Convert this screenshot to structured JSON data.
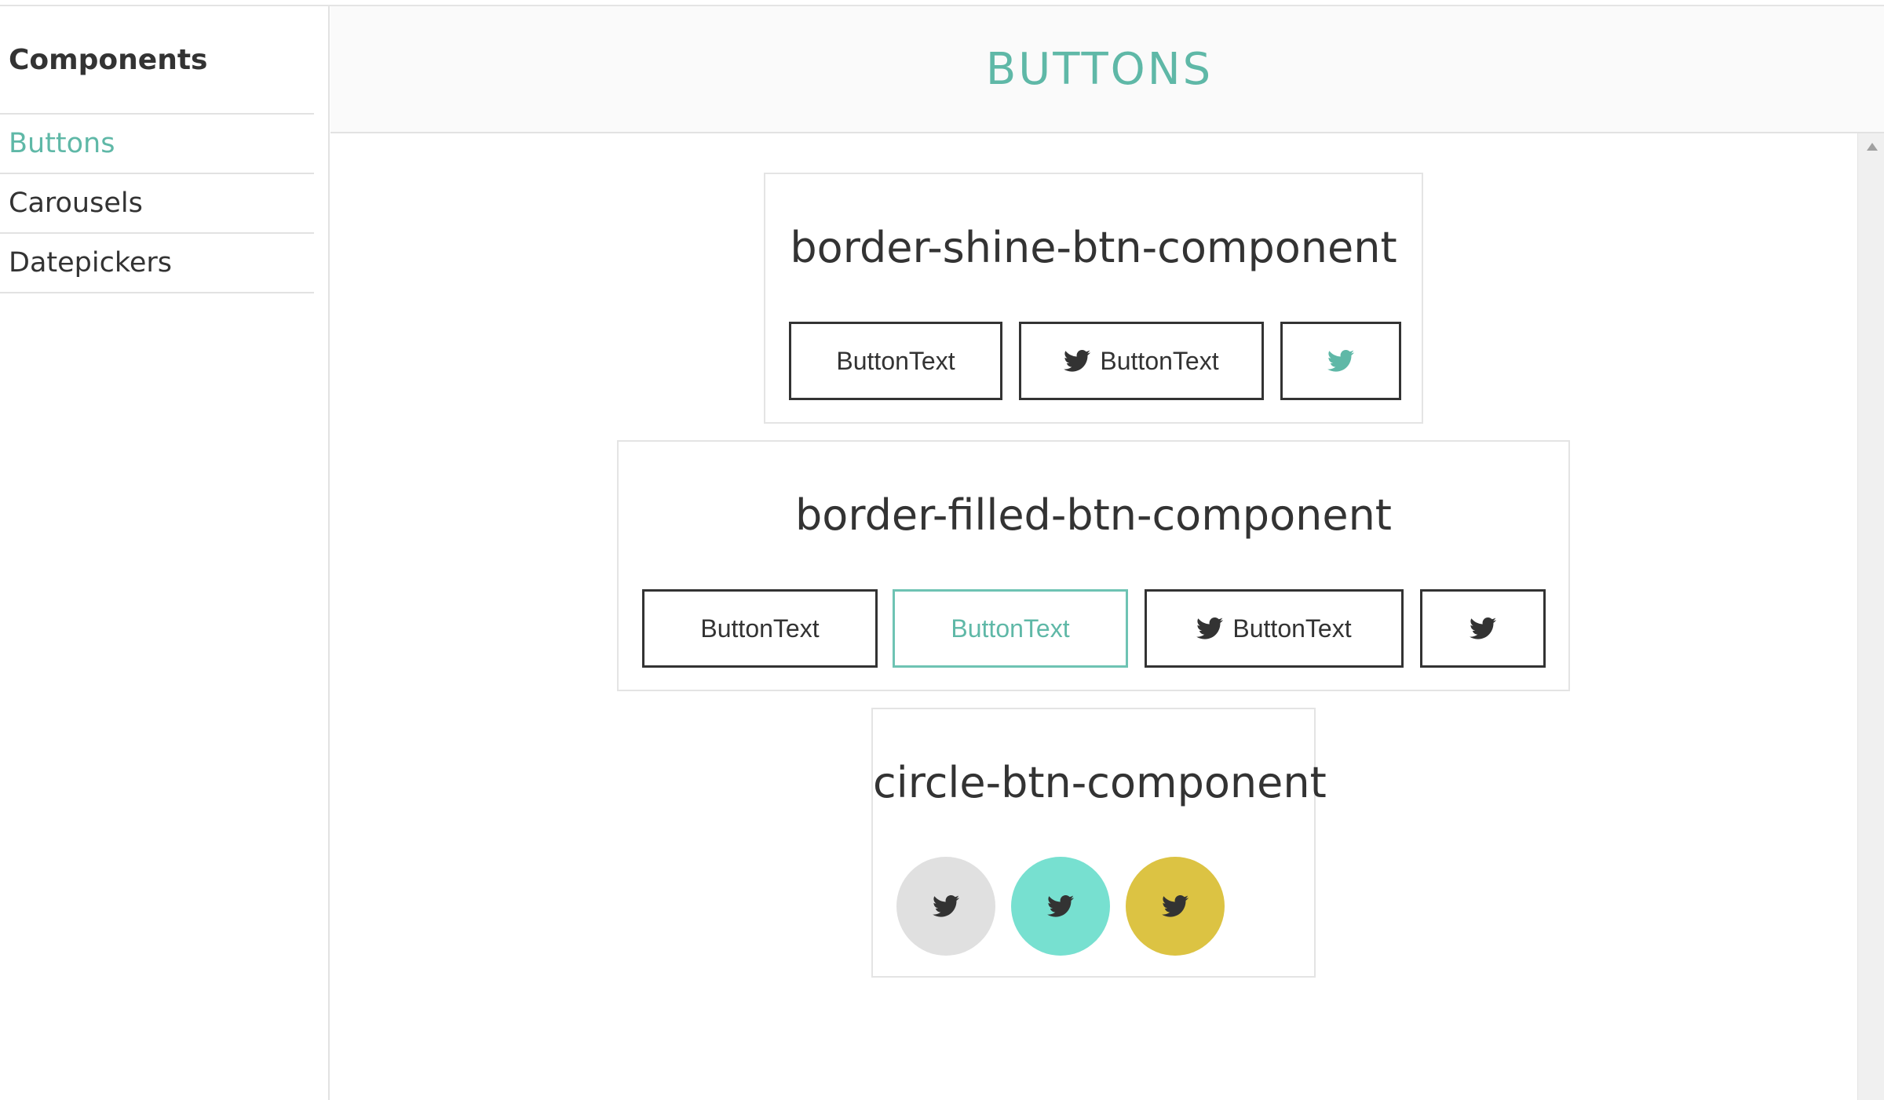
{
  "sidebar": {
    "heading": "Components",
    "items": [
      {
        "label": "Buttons",
        "active": true
      },
      {
        "label": "Carousels",
        "active": false
      },
      {
        "label": "Datepickers",
        "active": false
      }
    ]
  },
  "header": {
    "title": "BUTTONS"
  },
  "sections": {
    "border_shine": {
      "title": "border-shine-btn-component",
      "buttons": [
        {
          "label": "ButtonText",
          "icon": "twitter-icon"
        },
        {
          "label": "ButtonText",
          "icon": "twitter-icon"
        },
        {
          "label": "",
          "icon": "twitter-icon"
        }
      ]
    },
    "border_filled": {
      "title": "border-filled-btn-component",
      "buttons": [
        {
          "label": "ButtonText"
        },
        {
          "label": "ButtonText"
        },
        {
          "label": "ButtonText",
          "icon": "twitter-icon"
        },
        {
          "label": "",
          "icon": "twitter-icon"
        }
      ]
    },
    "circle": {
      "title": "circle-btn-component",
      "buttons": [
        {
          "icon": "twitter-icon",
          "color": "#e0e0e0"
        },
        {
          "icon": "twitter-icon",
          "color": "#77e0d0"
        },
        {
          "icon": "twitter-icon",
          "color": "#dcc343"
        }
      ]
    }
  },
  "colors": {
    "accent": "#5fb8a7",
    "text": "#333333",
    "border": "#e4e4e4"
  }
}
